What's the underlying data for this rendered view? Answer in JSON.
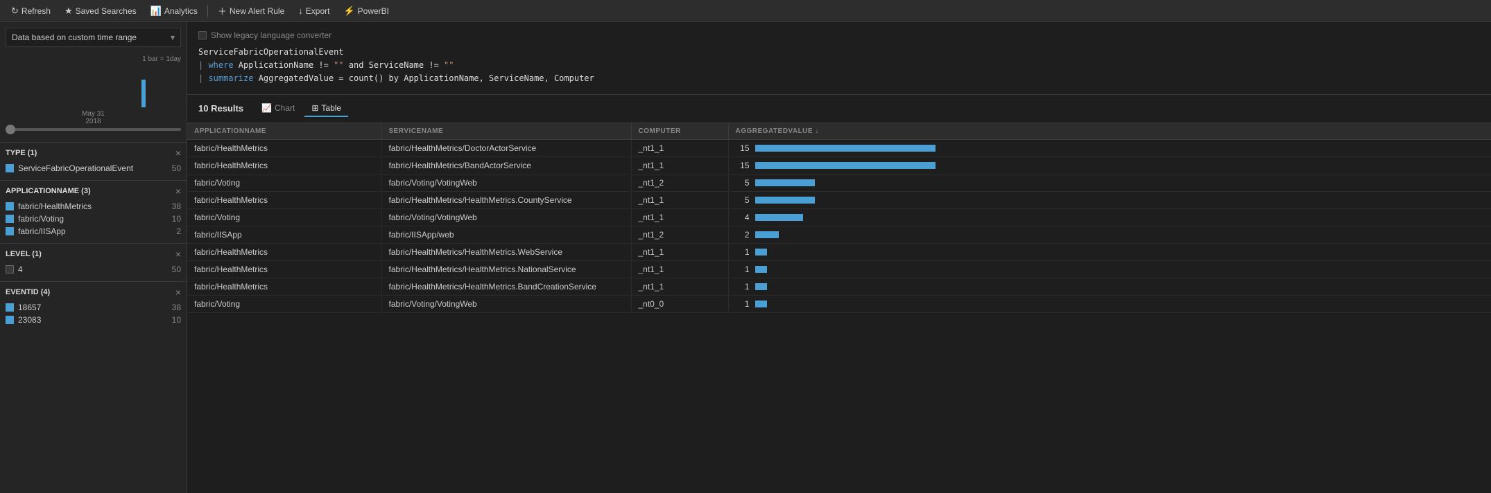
{
  "toolbar": {
    "refresh_label": "Refresh",
    "saved_searches_label": "Saved Searches",
    "analytics_label": "Analytics",
    "new_alert_label": "New Alert Rule",
    "export_label": "Export",
    "powerbi_label": "PowerBI"
  },
  "sidebar": {
    "time_range_label": "Data based on custom time range",
    "histogram": {
      "scale_label": "1 bar = 1day",
      "date_label": "May 31\n2018"
    },
    "filters": [
      {
        "title": "TYPE (1)",
        "items": [
          {
            "name": "ServiceFabricOperationalEvent",
            "count": "50",
            "checked": true
          }
        ]
      },
      {
        "title": "APPLICATIONNAME (3)",
        "items": [
          {
            "name": "fabric/HealthMetrics",
            "count": "38",
            "checked": true
          },
          {
            "name": "fabric/Voting",
            "count": "10",
            "checked": true
          },
          {
            "name": "fabric/IISApp",
            "count": "2",
            "checked": true
          }
        ]
      },
      {
        "title": "LEVEL (1)",
        "items": [
          {
            "name": "4",
            "count": "50",
            "checked": false
          }
        ]
      },
      {
        "title": "EVENTID (4)",
        "items": [
          {
            "name": "18657",
            "count": "38",
            "checked": true
          },
          {
            "name": "23083",
            "count": "10",
            "checked": true
          }
        ]
      }
    ]
  },
  "query": {
    "show_legacy_label": "Show legacy language converter",
    "line1": "ServiceFabricOperationalEvent",
    "line2": "| where ApplicationName != \"\" and ServiceName != \"\"",
    "line3": "| summarize AggregatedValue = count() by ApplicationName, ServiceName, Computer"
  },
  "results": {
    "count": "10",
    "count_label": "Results",
    "tabs": [
      {
        "id": "chart",
        "label": "Chart",
        "icon": "📈",
        "active": false
      },
      {
        "id": "table",
        "label": "Table",
        "icon": "⊞",
        "active": false
      }
    ],
    "columns": [
      {
        "key": "APPLICATIONNAME",
        "label": "APPLICATIONNAME"
      },
      {
        "key": "SERVICENAME",
        "label": "SERVICENAME"
      },
      {
        "key": "COMPUTER",
        "label": "COMPUTER"
      },
      {
        "key": "AGGREGATEDVALUE",
        "label": "AGGREGATEDVALUE ↓"
      }
    ],
    "rows": [
      {
        "appname": "fabric/HealthMetrics",
        "servicename": "fabric/HealthMetrics/DoctorActorService",
        "computer": "_nt1_1",
        "value": 15,
        "max": 15
      },
      {
        "appname": "fabric/HealthMetrics",
        "servicename": "fabric/HealthMetrics/BandActorService",
        "computer": "_nt1_1",
        "value": 15,
        "max": 15
      },
      {
        "appname": "fabric/Voting",
        "servicename": "fabric/Voting/VotingWeb",
        "computer": "_nt1_2",
        "value": 5,
        "max": 15
      },
      {
        "appname": "fabric/HealthMetrics",
        "servicename": "fabric/HealthMetrics/HealthMetrics.CountyService",
        "computer": "_nt1_1",
        "value": 5,
        "max": 15
      },
      {
        "appname": "fabric/Voting",
        "servicename": "fabric/Voting/VotingWeb",
        "computer": "_nt1_1",
        "value": 4,
        "max": 15
      },
      {
        "appname": "fabric/IISApp",
        "servicename": "fabric/IISApp/web",
        "computer": "_nt1_2",
        "value": 2,
        "max": 15
      },
      {
        "appname": "fabric/HealthMetrics",
        "servicename": "fabric/HealthMetrics/HealthMetrics.WebService",
        "computer": "_nt1_1",
        "value": 1,
        "max": 15
      },
      {
        "appname": "fabric/HealthMetrics",
        "servicename": "fabric/HealthMetrics/HealthMetrics.NationalService",
        "computer": "_nt1_1",
        "value": 1,
        "max": 15
      },
      {
        "appname": "fabric/HealthMetrics",
        "servicename": "fabric/HealthMetrics/HealthMetrics.BandCreationService",
        "computer": "_nt1_1",
        "value": 1,
        "max": 15
      },
      {
        "appname": "fabric/Voting",
        "servicename": "fabric/Voting/VotingWeb",
        "computer": "_nt0_0",
        "value": 1,
        "max": 15
      }
    ]
  }
}
